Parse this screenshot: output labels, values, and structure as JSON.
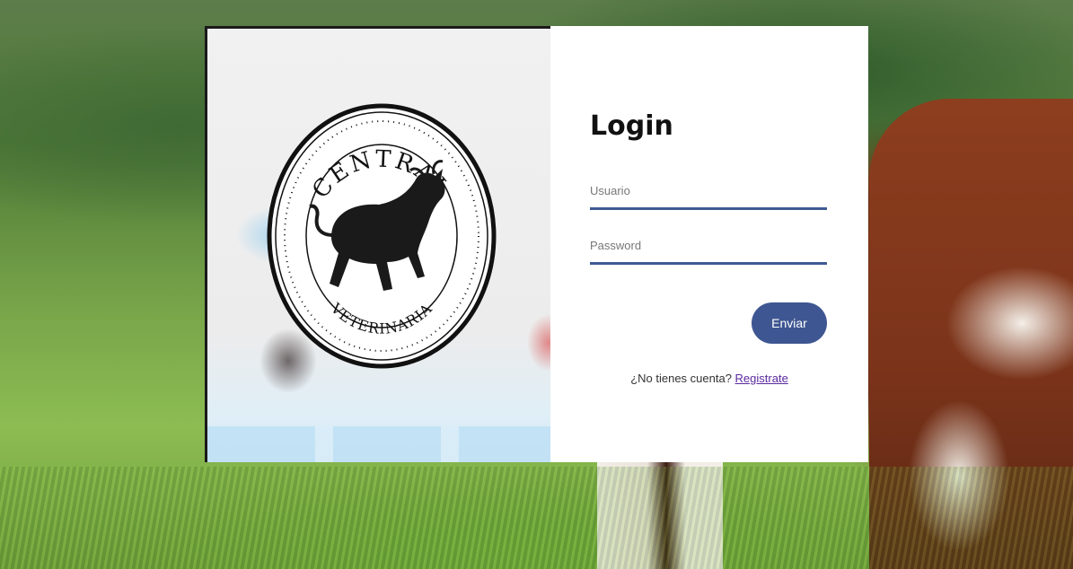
{
  "brand": {
    "logo_top_text": "CENTRAL",
    "logo_bottom_text": "VETERINARIA"
  },
  "login": {
    "title": "Login",
    "username_placeholder": "Usuario",
    "password_placeholder": "Password",
    "submit_label": "Enviar",
    "no_account_text": "¿No tienes cuenta?",
    "register_link": "Registrate"
  },
  "colors": {
    "accent": "#3e5691",
    "link": "#5b2aa0"
  }
}
